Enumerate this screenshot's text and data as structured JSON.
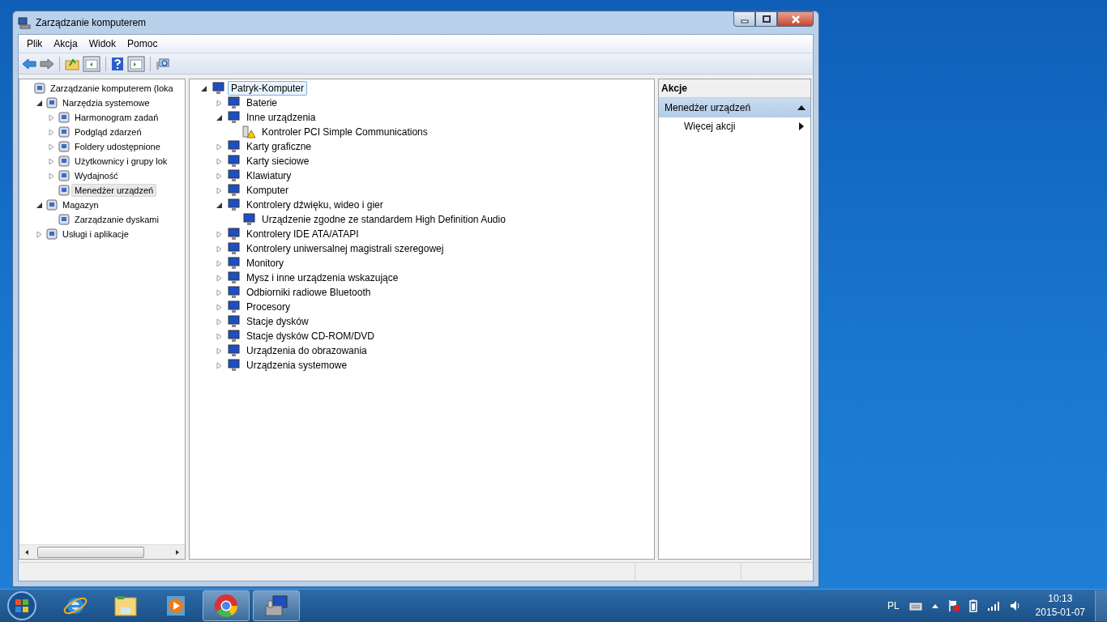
{
  "window": {
    "title": "Zarządzanie komputerem"
  },
  "menu": [
    "Plik",
    "Akcja",
    "Widok",
    "Pomoc"
  ],
  "nav_tree": [
    {
      "label": "Zarządzanie komputerem (loka",
      "selected": false,
      "children": [
        {
          "label": "Narzędzia systemowe",
          "selected": false,
          "expanded": true,
          "children": [
            {
              "label": "Harmonogram zadań",
              "selected": false,
              "expanded": false
            },
            {
              "label": "Podgląd zdarzeń",
              "selected": false,
              "expanded": false
            },
            {
              "label": "Foldery udostępnione",
              "selected": false,
              "expanded": false
            },
            {
              "label": "Użytkownicy i grupy lok",
              "selected": false,
              "expanded": false
            },
            {
              "label": "Wydajność",
              "selected": false,
              "expanded": false
            },
            {
              "label": "Menedżer urządzeń",
              "selected": true
            }
          ]
        },
        {
          "label": "Magazyn",
          "selected": false,
          "expanded": true,
          "children": [
            {
              "label": "Zarządzanie dyskami",
              "selected": false
            }
          ]
        },
        {
          "label": "Usługi i aplikacje",
          "selected": false,
          "expanded": false
        }
      ]
    }
  ],
  "device_tree": [
    {
      "label": "Patryk-Komputer",
      "selected": true,
      "expanded": true,
      "children": [
        {
          "label": "Baterie",
          "selected": false,
          "expanded": false
        },
        {
          "label": "Inne urządzenia",
          "selected": false,
          "expanded": true,
          "children": [
            {
              "label": "Kontroler PCI Simple Communications",
              "selected": false,
              "warning": true
            }
          ]
        },
        {
          "label": "Karty graficzne",
          "selected": false,
          "expanded": false
        },
        {
          "label": "Karty sieciowe",
          "selected": false,
          "expanded": false
        },
        {
          "label": "Klawiatury",
          "selected": false,
          "expanded": false
        },
        {
          "label": "Komputer",
          "selected": false,
          "expanded": false
        },
        {
          "label": "Kontrolery dźwięku, wideo i gier",
          "selected": false,
          "expanded": true,
          "children": [
            {
              "label": "Urządzenie zgodne ze standardem High Definition Audio",
              "selected": false
            }
          ]
        },
        {
          "label": "Kontrolery IDE ATA/ATAPI",
          "selected": false,
          "expanded": false
        },
        {
          "label": "Kontrolery uniwersalnej magistrali szeregowej",
          "selected": false,
          "expanded": false
        },
        {
          "label": "Monitory",
          "selected": false,
          "expanded": false
        },
        {
          "label": "Mysz i inne urządzenia wskazujące",
          "selected": false,
          "expanded": false
        },
        {
          "label": "Odbiorniki radiowe Bluetooth",
          "selected": false,
          "expanded": false
        },
        {
          "label": "Procesory",
          "selected": false,
          "expanded": false
        },
        {
          "label": "Stacje dysków",
          "selected": false,
          "expanded": false
        },
        {
          "label": "Stacje dysków CD-ROM/DVD",
          "selected": false,
          "expanded": false
        },
        {
          "label": "Urządzenia do obrazowania",
          "selected": false,
          "expanded": false
        },
        {
          "label": "Urządzenia systemowe",
          "selected": false,
          "expanded": false
        }
      ]
    }
  ],
  "actions": {
    "header": "Akcje",
    "section": {
      "title": "Menedżer urządzeń",
      "expanded": true
    },
    "items": [
      {
        "label": "Więcej akcji"
      }
    ]
  },
  "taskbar": {
    "apps": [
      {
        "kind": "ie",
        "active": false
      },
      {
        "kind": "explorer",
        "active": false
      },
      {
        "kind": "media",
        "active": false
      },
      {
        "kind": "chrome",
        "active": true
      },
      {
        "kind": "computer",
        "active": true
      }
    ],
    "language": "PL",
    "time": "10:13",
    "date": "2015-01-07"
  }
}
